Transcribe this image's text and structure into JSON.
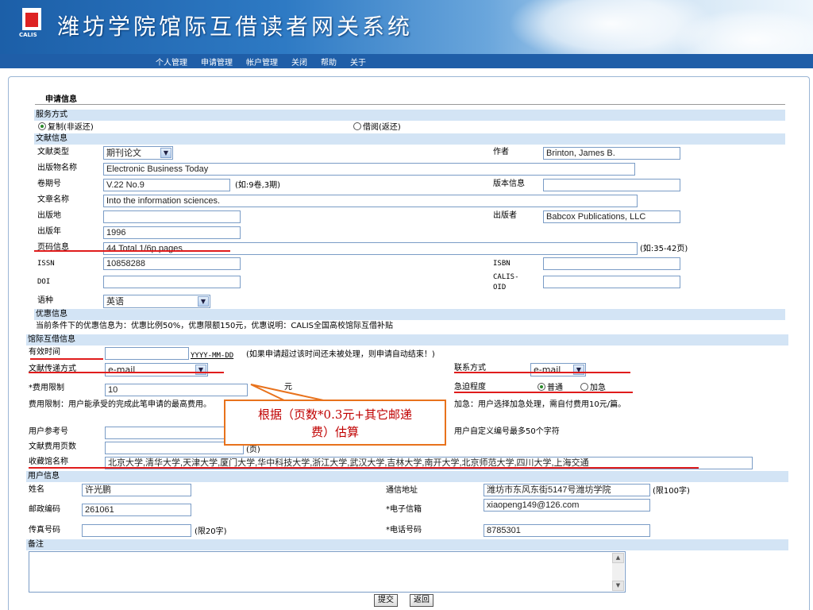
{
  "header": {
    "title": "潍坊学院馆际互借读者网关系统",
    "logo_text": "CALIS"
  },
  "nav": [
    "个人管理",
    "申请管理",
    "帐户管理",
    "关闭",
    "帮助",
    "关于"
  ],
  "section_title": "申请信息",
  "service": {
    "bar": "服务方式",
    "opt_copy": "复制(非返还)",
    "opt_loan": "借阅(返还)"
  },
  "doc": {
    "bar": "文献信息",
    "type_label": "文献类型",
    "type_value": "期刊论文",
    "author_label": "作者",
    "author_value": "Brinton, James B.",
    "pub_name_label": "出版物名称",
    "pub_name_value": "Electronic Business Today",
    "volume_label": "卷期号",
    "volume_value": "V.22 No.9",
    "volume_hint": "(如:9卷,3期)",
    "edition_label": "版本信息",
    "edition_value": "",
    "article_label": "文章名称",
    "article_value": "Into the information sciences.",
    "place_label": "出版地",
    "place_value": "",
    "publisher_label": "出版者",
    "publisher_value": "Babcox Publications, LLC",
    "year_label": "出版年",
    "year_value": "1996",
    "pages_label": "页码信息",
    "pages_value": "44 Total 1/6p pages",
    "pages_hint": "(如:35-42页)",
    "issn_label": "ISSN",
    "issn_value": "10858288",
    "isbn_label": "ISBN",
    "isbn_value": "",
    "doi_label": "DOI",
    "doi_value": "",
    "oid_label": "CALIS-OID",
    "oid_value": "",
    "lang_label": "语种",
    "lang_value": "英语"
  },
  "discount": {
    "bar": "优惠信息",
    "text": "当前条件下的优惠信息为：优惠比例50%，优惠限额150元，优惠说明：CALIS全国高校馆际互借补贴"
  },
  "ill": {
    "bar": "馆际互借信息",
    "valid_label": "有效时间",
    "valid_value": "",
    "valid_hint": "YYYY-MM-DD",
    "valid_note": "(如果申请超过该时间还未被处理，则申请自动结束！)",
    "delivery_label": "文献传递方式",
    "delivery_value": "e-mail",
    "contact_label": "联系方式",
    "contact_value": "e-mail",
    "fee_label": "*费用限制",
    "fee_value": "10",
    "fee_unit": "元",
    "urgency_label": "急迫程度",
    "urgency_normal": "普通",
    "urgency_urgent": "加急",
    "fee_note": "费用限制：用户能承受的完成此笔申请的最高费用。",
    "urgent_note": "加急：用户选择加急处理，需自付费用10元/篇。",
    "ref_label": "用户参考号",
    "ref_value": "",
    "ref_note": "用户自定义编号最多50个字符",
    "pagecount_label": "文献费用页数",
    "pagecount_value": "",
    "pagecount_unit": "(页)",
    "library_label": "收藏馆名称",
    "library_value": "北京大学,清华大学,天津大学,厦门大学,华中科技大学,浙江大学,武汉大学,吉林大学,南开大学,北京师范大学,四川大学,上海交通"
  },
  "user": {
    "bar": "用户信息",
    "name_label": "姓名",
    "name_value": "许光鹏",
    "address_label": "通信地址",
    "address_value": "潍坊市东风东街5147号潍坊学院",
    "address_hint": "(限100字)",
    "zip_label": "邮政编码",
    "zip_value": "261061",
    "email_label": "*电子信箱",
    "email_value": "xiaopeng149@126.com",
    "fax_label": "传真号码",
    "fax_value": "",
    "fax_hint": "(限20字)",
    "phone_label": "*电话号码",
    "phone_value": "8785301"
  },
  "remarks": {
    "bar": "备注",
    "value": ""
  },
  "buttons": {
    "submit": "提交",
    "back": "返回"
  },
  "callout": {
    "line1": "根据（页数*0.3元+其它邮递",
    "line2": "费）估算"
  },
  "colors": {
    "banner": "#1f5ea8",
    "bar": "#d3e4f5",
    "annotation": "#e01c1c",
    "callout_border": "#e8721c"
  }
}
